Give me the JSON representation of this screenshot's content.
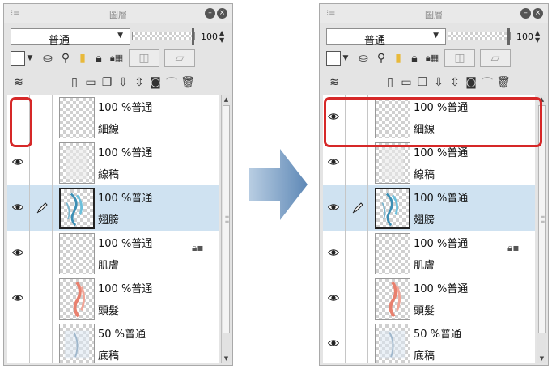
{
  "panels": {
    "left": {
      "title": "圖層",
      "blend_mode": "普通",
      "opacity": "100",
      "highlight": "visibility-column",
      "layers": [
        {
          "info": "100 %普通",
          "name": "細線",
          "visible": false,
          "editing": false,
          "selected": false,
          "locked": false,
          "thumbnail": "blank"
        },
        {
          "info": "100 %普通",
          "name": "線稿",
          "visible": true,
          "editing": false,
          "selected": false,
          "locked": false,
          "thumbnail": "faint"
        },
        {
          "info": "100 %普通",
          "name": "翅膀",
          "visible": true,
          "editing": true,
          "selected": true,
          "locked": false,
          "thumbnail": "wing"
        },
        {
          "info": "100 %普通",
          "name": "肌膚",
          "visible": true,
          "editing": false,
          "selected": false,
          "locked": true,
          "thumbnail": "blank"
        },
        {
          "info": "100 %普通",
          "name": "頭髮",
          "visible": true,
          "editing": false,
          "selected": false,
          "locked": false,
          "thumbnail": "hair"
        },
        {
          "info": "50 %普通",
          "name": "底稿",
          "visible": false,
          "editing": false,
          "selected": false,
          "locked": false,
          "thumbnail": "sketch"
        }
      ]
    },
    "right": {
      "title": "圖層",
      "blend_mode": "普通",
      "opacity": "100",
      "highlight": "first-layer-row",
      "layers": [
        {
          "info": "100 %普通",
          "name": "細線",
          "visible": true,
          "editing": false,
          "selected": false,
          "locked": false,
          "thumbnail": "blank"
        },
        {
          "info": "100 %普通",
          "name": "線稿",
          "visible": true,
          "editing": false,
          "selected": false,
          "locked": false,
          "thumbnail": "faint"
        },
        {
          "info": "100 %普通",
          "name": "翅膀",
          "visible": true,
          "editing": true,
          "selected": true,
          "locked": false,
          "thumbnail": "wing"
        },
        {
          "info": "100 %普通",
          "name": "肌膚",
          "visible": true,
          "editing": false,
          "selected": false,
          "locked": true,
          "thumbnail": "blank"
        },
        {
          "info": "100 %普通",
          "name": "頭髮",
          "visible": true,
          "editing": false,
          "selected": false,
          "locked": false,
          "thumbnail": "hair"
        },
        {
          "info": "50 %普通",
          "name": "底稿",
          "visible": true,
          "editing": false,
          "selected": false,
          "locked": false,
          "thumbnail": "sketch"
        }
      ]
    }
  },
  "colors": {
    "highlight": "#d62828",
    "selected_row": "#cfe2f1",
    "arrow": "#6f95be"
  },
  "icons": {
    "lock": "lock-icon",
    "eye": "eye-icon",
    "pen": "pen-icon"
  }
}
